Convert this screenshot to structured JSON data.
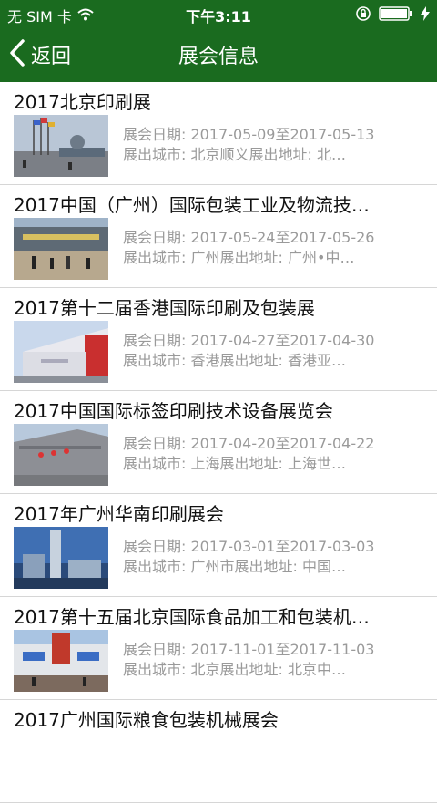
{
  "status_bar": {
    "carrier": "无 SIM 卡",
    "time": "下午3:11"
  },
  "nav": {
    "back_label": "返回",
    "title": "展会信息"
  },
  "labels": {
    "date_prefix": "展会日期:",
    "date_sep": "至",
    "city_prefix": "展出城市:",
    "address_prefix": "展出地址:"
  },
  "exhibitions": [
    {
      "title": "2017北京印刷展",
      "start": "2017-05-09",
      "end": "2017-05-13",
      "city": "北京顺义",
      "address": "北…"
    },
    {
      "title": "2017中国（广州）国际包装工业及物流技…",
      "start": "2017-05-24",
      "end": "2017-05-26",
      "city": "广州",
      "address": "广州•中…"
    },
    {
      "title": "2017第十二届香港国际印刷及包装展",
      "start": "2017-04-27",
      "end": "2017-04-30",
      "city": "香港",
      "address": "香港亚…"
    },
    {
      "title": "2017中国国际标签印刷技术设备展览会",
      "start": "2017-04-20",
      "end": "2017-04-22",
      "city": "上海",
      "address": "上海世…"
    },
    {
      "title": "2017年广州华南印刷展会",
      "start": "2017-03-01",
      "end": "2017-03-03",
      "city": "广州市",
      "address": "中国…"
    },
    {
      "title": "2017第十五届北京国际食品加工和包装机…",
      "start": "2017-11-01",
      "end": "2017-11-03",
      "city": "北京",
      "address": "北京中…"
    },
    {
      "title": "2017广州国际粮食包装机械展会"
    }
  ],
  "colors": {
    "header_green": "#1a6b1f",
    "meta_gray": "#9a9a9a",
    "title_text": "#111111"
  }
}
